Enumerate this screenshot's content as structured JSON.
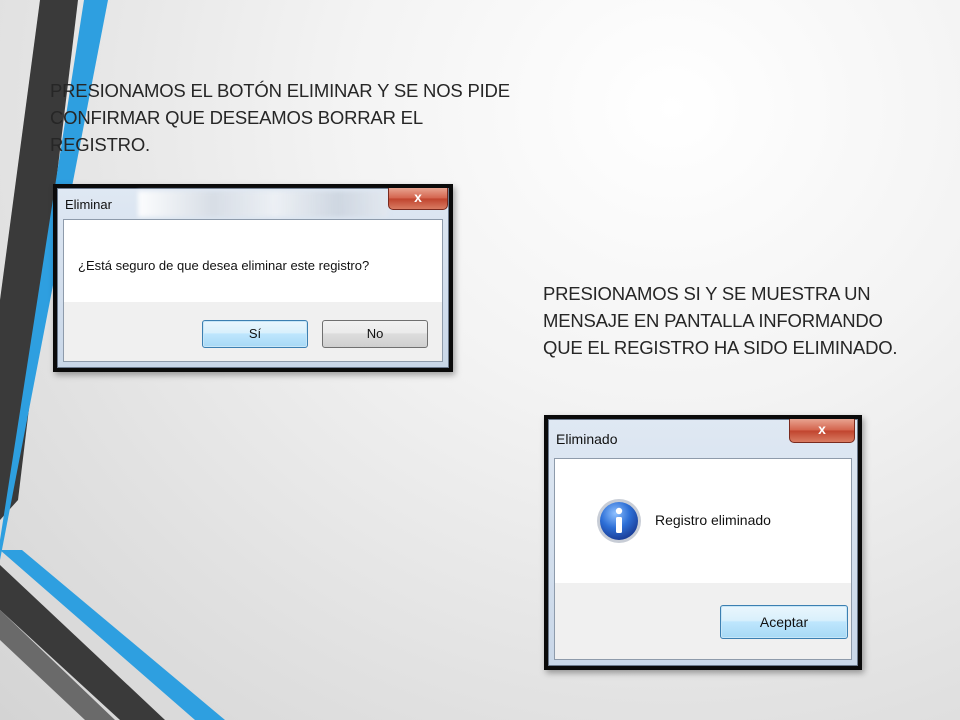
{
  "slide": {
    "caption_1": "PRESIONAMOS EL BOTÓN ELIMINAR Y SE NOS PIDE CONFIRMAR QUE DESEAMOS BORRAR EL REGISTRO.",
    "caption_2": "PRESIONAMOS SI Y SE MUESTRA UN MENSAJE EN PANTALLA INFORMANDO QUE EL REGISTRO HA SIDO ELIMINADO.",
    "accent_colors": {
      "blue": "#2e9fe0",
      "dark": "#3c3c3c"
    }
  },
  "dialog_confirm": {
    "title": "Eliminar",
    "close_glyph": "x",
    "message": "¿Está seguro de que desea eliminar este registro?",
    "yes_label": "Sí",
    "no_label": "No"
  },
  "dialog_info": {
    "title": "Eliminado",
    "close_glyph": "x",
    "icon": "info-icon",
    "message": "Registro eliminado",
    "accept_label": "Aceptar"
  }
}
